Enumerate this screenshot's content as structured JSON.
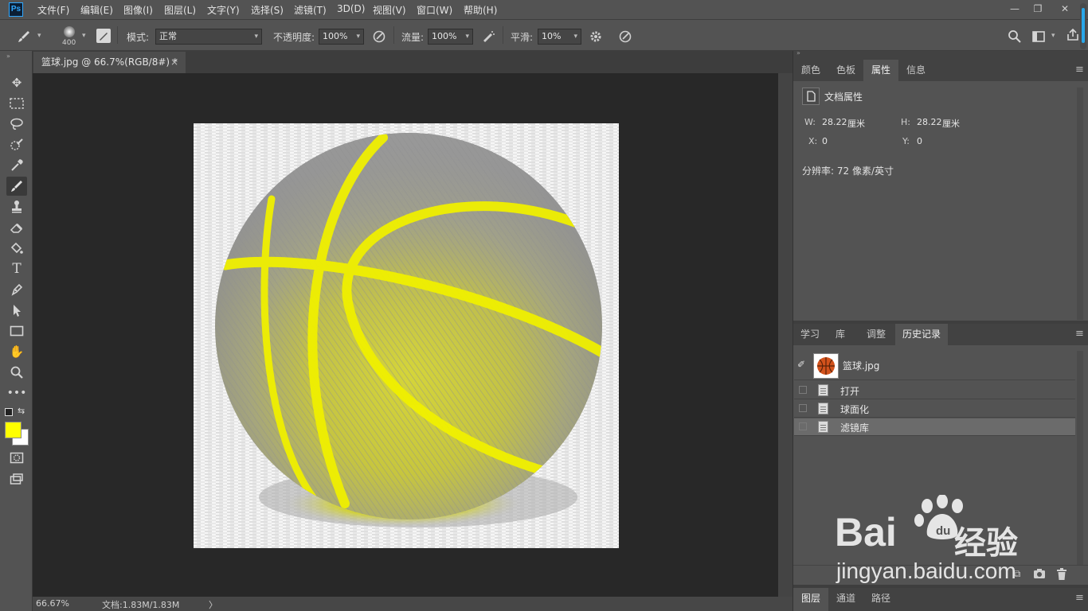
{
  "app": {
    "logo": "Ps"
  },
  "menu": [
    "文件(F)",
    "编辑(E)",
    "图像(I)",
    "图层(L)",
    "文字(Y)",
    "选择(S)",
    "滤镜(T)",
    "3D(D)",
    "视图(V)",
    "窗口(W)",
    "帮助(H)"
  ],
  "window_controls": {
    "minimize": "—",
    "restore": "❐",
    "close": "✕"
  },
  "options": {
    "brush_size": "400",
    "mode_label": "模式:",
    "mode_value": "正常",
    "opacity_label": "不透明度:",
    "opacity_value": "100%",
    "flow_label": "流量:",
    "flow_value": "100%",
    "smoothing_label": "平滑:",
    "smoothing_value": "10%"
  },
  "document": {
    "tab_title": "篮球.jpg @ 66.7%(RGB/8#) *",
    "tab_close": "×",
    "zoom": "66.67%",
    "doc_size": "文档:1.83M/1.83M",
    "status_arrow": "〉"
  },
  "colors": {
    "foreground": "#ffff00",
    "background": "#ffffff",
    "ui_bg": "#535353",
    "canvas_bg": "#282828"
  },
  "panel_top": {
    "tabs": [
      "颜色",
      "色板",
      "属性",
      "信息"
    ],
    "active_tab": "属性",
    "section_title": "文档属性",
    "w_label": "W:",
    "w_value": "28.22",
    "w_unit": "厘米",
    "h_label": "H:",
    "h_value": "28.22",
    "h_unit": "厘米",
    "x_label": "X:",
    "x_value": "0",
    "y_label": "Y:",
    "y_value": "0",
    "resolution": "分辨率: 72 像素/英寸"
  },
  "panel_history": {
    "tabs": [
      "学习",
      "库",
      "调整",
      "历史记录"
    ],
    "active_tab": "历史记录",
    "snapshot_name": "篮球.jpg",
    "steps": [
      {
        "label": "打开",
        "selected": false
      },
      {
        "label": "球面化",
        "selected": false
      },
      {
        "label": "滤镜库",
        "selected": true
      }
    ]
  },
  "panel_layers": {
    "tabs": [
      "图层",
      "通道",
      "路径"
    ]
  },
  "watermark": {
    "brand": "Bai",
    "brand2": "du",
    "cn": "经验",
    "url": "jingyan.baidu.com"
  }
}
